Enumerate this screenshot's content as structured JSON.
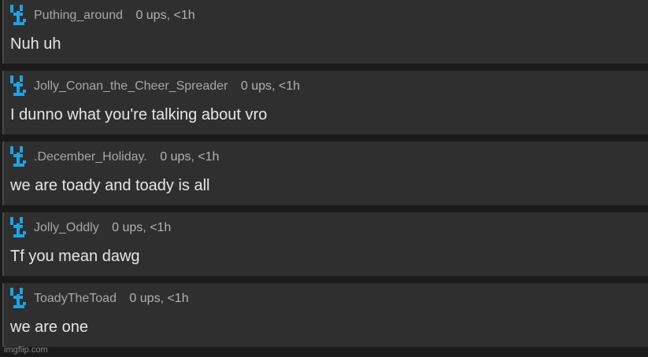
{
  "colors": {
    "background": "#1b1b1b",
    "comment_bg": "#2f2f2f",
    "meta_text": "#a7a7a7",
    "comment_text": "#e6e6e6",
    "avatar_accent": "#1aa4e8"
  },
  "comments": [
    {
      "avatar_icon": "blue-pixel-figure-icon",
      "username": "Puthing_around",
      "stats": "0 ups, <1h",
      "text": "Nuh uh"
    },
    {
      "avatar_icon": "blue-pixel-figure-icon",
      "username": "Jolly_Conan_the_Cheer_Spreader",
      "stats": "0 ups, <1h",
      "text": "I dunno what you're talking about vro"
    },
    {
      "avatar_icon": "blue-pixel-figure-icon",
      "username": ".December_Holiday.",
      "stats": "0 ups, <1h",
      "text": "we are toady and toady is all"
    },
    {
      "avatar_icon": "blue-pixel-figure-icon",
      "username": "Jolly_Oddly",
      "stats": "0 ups, <1h",
      "text": "Tf you mean dawg"
    },
    {
      "avatar_icon": "blue-pixel-figure-icon",
      "username": "ToadyTheToad",
      "stats": "0 ups, <1h",
      "text": "we are one"
    }
  ],
  "watermark": "imgflip.com"
}
